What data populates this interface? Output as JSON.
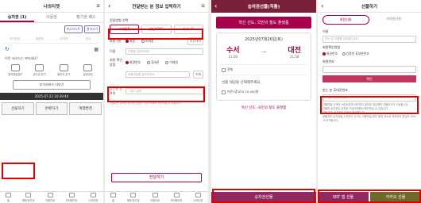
{
  "panel1": {
    "title": "나의티켓",
    "tabs": [
      "승차권 (1)",
      "이용권",
      "정기권·패스"
    ],
    "chips": [
      "위시리스트",
      "열차시각"
    ],
    "grid_labels": [
      "좌석번호",
      "출발역",
      "도착역",
      "운임"
    ],
    "prompt": "이런 서비스는 어떠세요?",
    "icons": [
      "열차출발정보",
      "승차권 받기",
      "동반자 추가",
      "일정공유"
    ],
    "side_btn": "부가서비스 더보기",
    "dark_bar": "2025-07-22 10:39:44",
    "bottom_btns": [
      "선물하기",
      "반환하기",
      "여행변경"
    ],
    "nav": [
      "홈",
      "예매·정기권",
      "이용안내",
      "마이페이지",
      "나의티켓"
    ]
  },
  "panel2": {
    "title": "전달받는 분 정보 입력하기",
    "section": "전달방법 선택",
    "methods": [
      "코레일톡",
      "일반(SMS)",
      "카카오톡"
    ],
    "member_label": "회원구분",
    "member_opts": [
      "회원",
      "비회원"
    ],
    "member_extra": "이전내역",
    "name_label": "이름",
    "name_ph": "이름을 입력하세요.",
    "id_label": "회원 확인방법",
    "id_opts": [
      "회원번호",
      "휴대폰",
      "이메일"
    ],
    "id_ph": "회원번호를 입력하세요.",
    "search": "조회",
    "phone_label": "받는분 연락처",
    "phone_ph": "'-'없이 입력",
    "note": "전달받는 분께는 승차권/이용권 구입이력에서 확인하실 수 있습니다.",
    "submit": "전달하기",
    "nav": [
      "홈",
      "예매·정기권",
      "이용안내",
      "마이페이지",
      "나의티켓"
    ]
  },
  "panel3": {
    "title": "승차권선물(직통)",
    "banner": "혁신 선도, 국민의 철도 플랫폼",
    "date": "2025년07월26일(토)",
    "from": "수서",
    "from_time": "21:00",
    "to": "대전",
    "to_time": "21:58",
    "check_all": "전체",
    "select_text": "선물 대상을 선택해주세요.",
    "item": "어른1명 KTX 20,000원",
    "footer": "혁신 선도, 국민의 철도 플랫폼",
    "bottom_btn": "승차권선물"
  },
  "panel4": {
    "title": "선물하기",
    "tabs": [
      "회원선물",
      "비회원선물"
    ],
    "name_label": "이름",
    "name_ph": "받는 분 이름을 입력해주세요",
    "method_label": "회원확인방법",
    "method_opts": [
      "회원번호",
      "인증된 휴대폰번호"
    ],
    "member_label": "회원번호",
    "confirm": "확인",
    "phone_label": "받는 분 휴대폰번호",
    "phone_ph": "'-' 없이 입력하세요",
    "bullets": [
      "선물받을 고객의 스마트폰에 SRT앱이 설치된 경우에만 선물하기가 가능합니다.",
      "선물한 승차권은 승차권 구입이력에서 확인하실 수 있습니다.",
      "선물 받은 승차권은 반환이 불가합니다.",
      "환불처리 승차권을 소지하고 있거나 이용하실 경우 발권 취소로 처리되어 운임의 50%가 부가됩니다."
    ],
    "btn_srt": "SRT 앱 선물",
    "btn_kakao": "카카오 선물"
  }
}
